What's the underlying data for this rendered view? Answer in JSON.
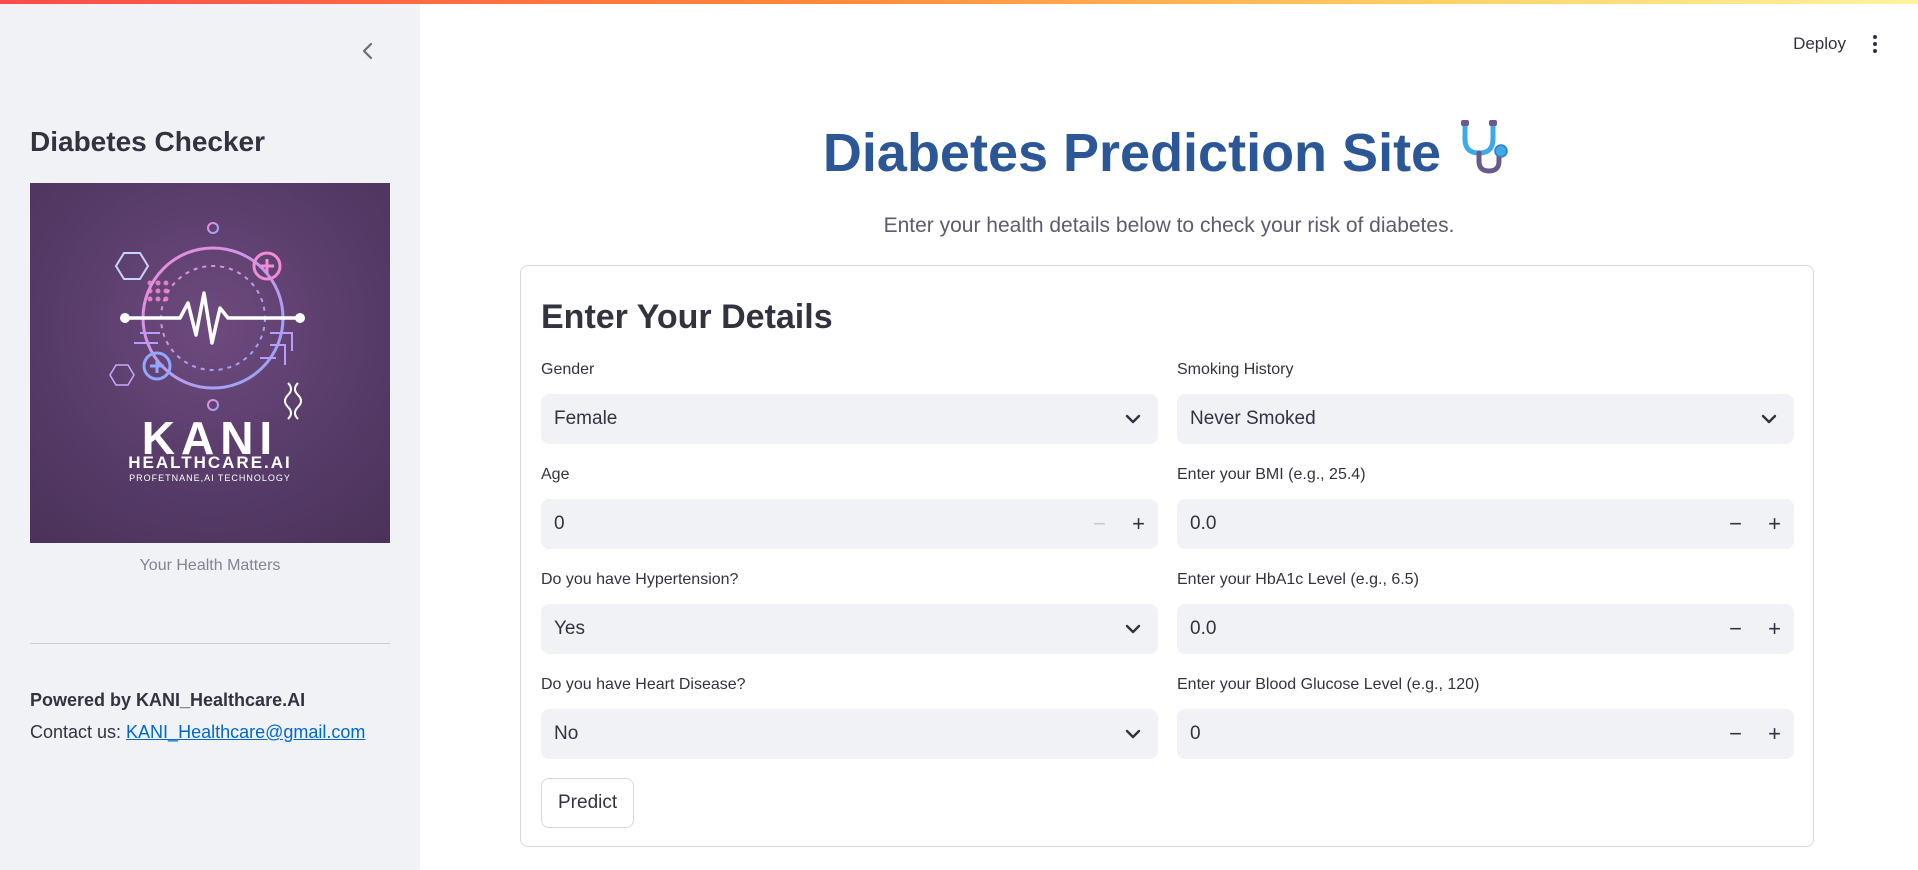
{
  "header": {
    "deploy_label": "Deploy"
  },
  "sidebar": {
    "title": "Diabetes Checker",
    "logo": {
      "main_text": "KANI",
      "sub_text": "HEALTHCARE.AI",
      "tagline": "PROFETNANE,AI TECHNOLOGY"
    },
    "caption": "Your Health Matters",
    "powered_by": "Powered by KANI_Healthcare.AI",
    "contact_prefix": "Contact us: ",
    "contact_email": "KANI_Healthcare@gmail.com"
  },
  "main": {
    "title": "Diabetes Prediction Site",
    "title_icon": "stethoscope-icon",
    "subtitle": "Enter your health details below to check your risk of diabetes.",
    "form": {
      "title": "Enter Your Details",
      "gender": {
        "label": "Gender",
        "value": "Female"
      },
      "smoking": {
        "label": "Smoking History",
        "value": "Never Smoked"
      },
      "age": {
        "label": "Age",
        "value": "0"
      },
      "bmi": {
        "label": "Enter your BMI (e.g., 25.4)",
        "value": "0.0"
      },
      "hypertension": {
        "label": "Do you have Hypertension?",
        "value": "Yes"
      },
      "hba1c": {
        "label": "Enter your HbA1c Level (e.g., 6.5)",
        "value": "0.0"
      },
      "heart": {
        "label": "Do you have Heart Disease?",
        "value": "No"
      },
      "glucose": {
        "label": "Enter your Blood Glucose Level (e.g., 120)",
        "value": "0"
      },
      "predict_label": "Predict"
    }
  },
  "colors": {
    "title": "#2b5797",
    "accent_link": "#0068c9",
    "sidebar_bg": "#f0f2f6"
  }
}
